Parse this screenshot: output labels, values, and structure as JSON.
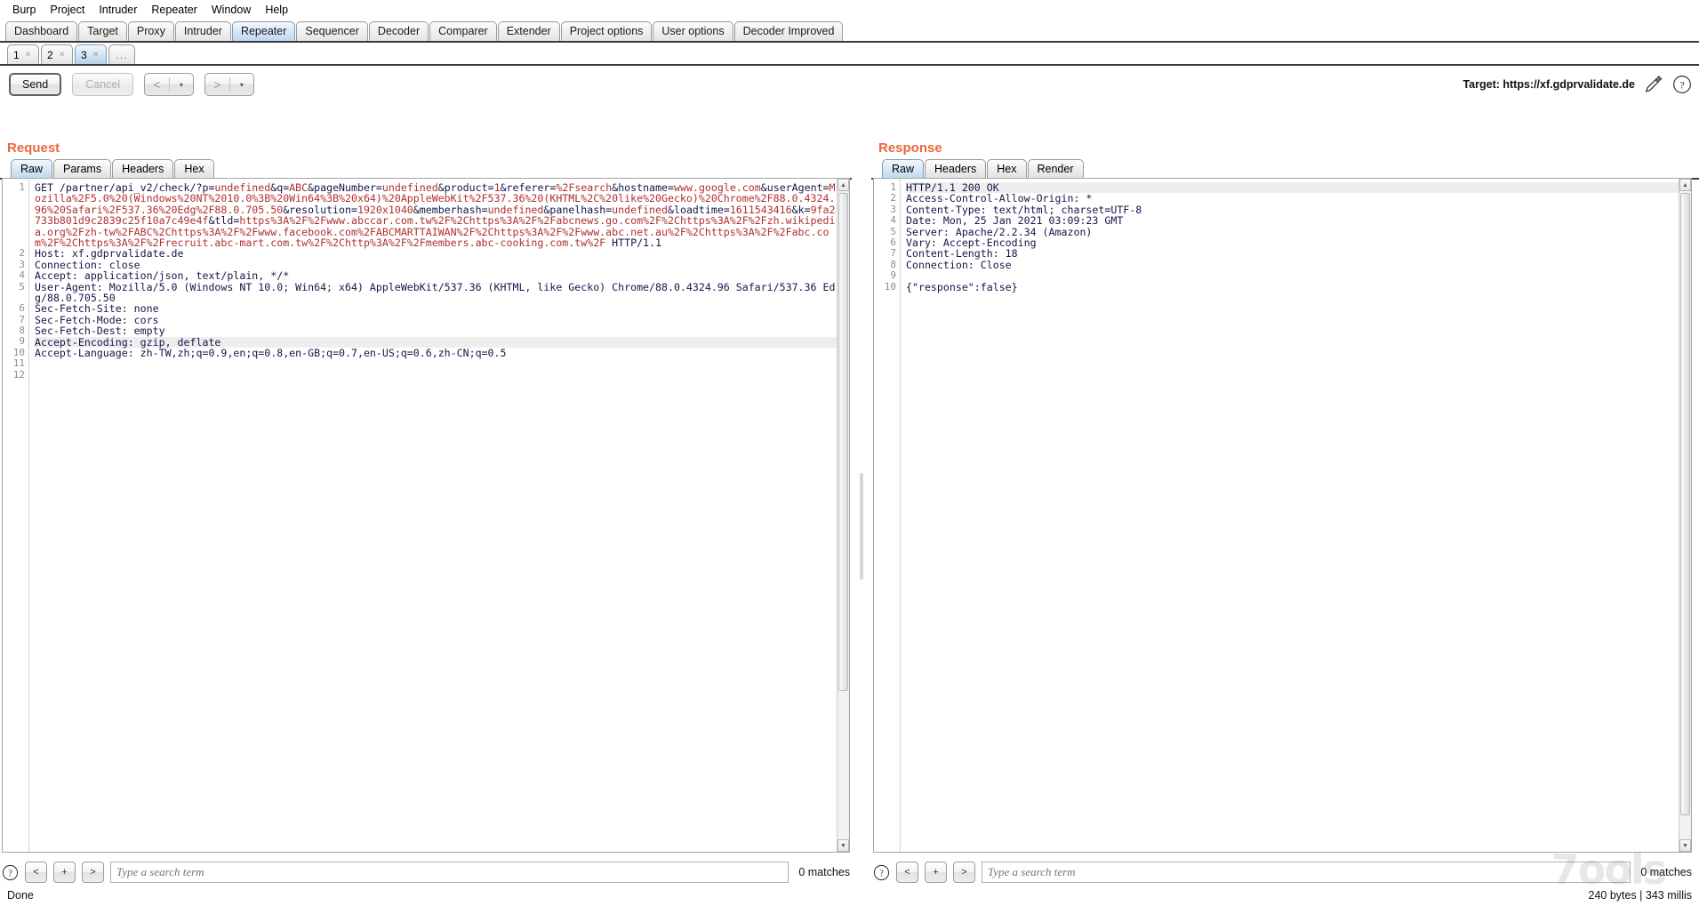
{
  "menu": {
    "items": [
      "Burp",
      "Project",
      "Intruder",
      "Repeater",
      "Window",
      "Help"
    ]
  },
  "main_tabs": {
    "selected": "Repeater",
    "items": [
      "Dashboard",
      "Target",
      "Proxy",
      "Intruder",
      "Repeater",
      "Sequencer",
      "Decoder",
      "Comparer",
      "Extender",
      "Project options",
      "User options",
      "Decoder Improved"
    ]
  },
  "repeater_tabs": {
    "selected": "3",
    "items": [
      "1",
      "2",
      "3"
    ],
    "close_glyph": "×",
    "more_label": "..."
  },
  "toolbar": {
    "send_label": "Send",
    "cancel_label": "Cancel",
    "back_glyph": "<",
    "forward_glyph": ">",
    "caret_glyph": "▾",
    "target_label": "Target: https://xf.gdprvalidate.de",
    "edit_icon": "pencil-icon",
    "help_icon": "question-mark-icon"
  },
  "request": {
    "title": "Request",
    "tabs": [
      "Raw",
      "Params",
      "Headers",
      "Hex"
    ],
    "selected_tab": "Raw",
    "line_numbers": [
      "1",
      "2",
      "3",
      "4",
      "5",
      "6",
      "7",
      "8",
      "9",
      "10",
      "11",
      "12"
    ],
    "lines": [
      {
        "n": "1",
        "segments": [
          {
            "t": "GET /partner/api_v2/check/?p=",
            "c": "blue"
          },
          {
            "t": "undefined",
            "c": "red"
          },
          {
            "t": "&q=",
            "c": "blue"
          },
          {
            "t": "ABC",
            "c": "red"
          },
          {
            "t": "&pageNumber=",
            "c": "blue"
          },
          {
            "t": "undefined",
            "c": "red"
          },
          {
            "t": "&product=",
            "c": "blue"
          },
          {
            "t": "1",
            "c": "red"
          },
          {
            "t": "&referer=",
            "c": "blue"
          },
          {
            "t": "%2Fsearch",
            "c": "red"
          },
          {
            "t": "&hostname=",
            "c": "blue"
          },
          {
            "t": "www.google.com",
            "c": "red"
          },
          {
            "t": "&userAgent=",
            "c": "blue"
          },
          {
            "t": "Mozilla%2F5.0%20(Windows%20NT%2010.0%3B%20Win64%3B%20x64)%20AppleWebKit%2F537.36%20(KHTML%2C%20like%20Gecko)%20Chrome%2F88.0.4324.96%20Safari%2F537.36%20Edg%2F88.0.705.50",
            "c": "red"
          },
          {
            "t": "&resolution=",
            "c": "blue"
          },
          {
            "t": "1920x1040",
            "c": "red"
          },
          {
            "t": "&memberhash=",
            "c": "blue"
          },
          {
            "t": "undefined",
            "c": "red"
          },
          {
            "t": "&panelhash=",
            "c": "blue"
          },
          {
            "t": "undefined",
            "c": "red"
          },
          {
            "t": "&loadtime=",
            "c": "blue"
          },
          {
            "t": "1611543416",
            "c": "red"
          },
          {
            "t": "&k=",
            "c": "blue"
          },
          {
            "t": "9fa2733b801d9c2839c25f10a7c49e4f",
            "c": "red"
          },
          {
            "t": "&tld=",
            "c": "blue"
          },
          {
            "t": "https%3A%2F%2Fwww.abccar.com.tw%2F%2Chttps%3A%2F%2Fabcnews.go.com%2F%2Chttps%3A%2F%2Fzh.wikipedia.org%2Fzh-tw%2FABC%2Chttps%3A%2F%2Fwww.facebook.com%2FABCMARTTAIWAN%2F%2Chttps%3A%2F%2Fwww.abc.net.au%2F%2Chttps%3A%2F%2Fabc.com%2F%2Chttps%3A%2F%2Frecruit.abc-mart.com.tw%2F%2Chttp%3A%2F%2Fmembers.abc-cooking.com.tw%2F",
            "c": "red"
          },
          {
            "t": " HTTP/1.1",
            "c": "blue"
          }
        ]
      },
      {
        "n": "2",
        "segments": [
          {
            "t": "Host: xf.gdprvalidate.de",
            "c": "blue"
          }
        ]
      },
      {
        "n": "3",
        "segments": [
          {
            "t": "Connection: close",
            "c": "blue"
          }
        ]
      },
      {
        "n": "4",
        "segments": [
          {
            "t": "Accept: application/json, text/plain, */*",
            "c": "blue"
          }
        ]
      },
      {
        "n": "5",
        "segments": [
          {
            "t": "User-Agent: Mozilla/5.0 (Windows NT 10.0; Win64; x64) AppleWebKit/537.36 (KHTML, like Gecko) Chrome/88.0.4324.96 Safari/537.36 Edg/88.0.705.50",
            "c": "blue"
          }
        ]
      },
      {
        "n": "6",
        "segments": [
          {
            "t": "Sec-Fetch-Site: none",
            "c": "blue"
          }
        ]
      },
      {
        "n": "7",
        "segments": [
          {
            "t": "Sec-Fetch-Mode: cors",
            "c": "blue"
          }
        ]
      },
      {
        "n": "8",
        "segments": [
          {
            "t": "Sec-Fetch-Dest: empty",
            "c": "blue"
          }
        ]
      },
      {
        "n": "9",
        "highlight": true,
        "segments": [
          {
            "t": "Accept-Encoding: gzip, deflate",
            "c": "blue"
          }
        ]
      },
      {
        "n": "10",
        "segments": [
          {
            "t": "Accept-Language: zh-TW,zh;q=0.9,en;q=0.8,en-GB;q=0.7,en-US;q=0.6,zh-CN;q=0.5",
            "c": "blue"
          }
        ]
      },
      {
        "n": "11",
        "segments": [
          {
            "t": "",
            "c": "blue"
          }
        ]
      },
      {
        "n": "12",
        "segments": [
          {
            "t": "",
            "c": "blue"
          }
        ]
      }
    ],
    "search": {
      "placeholder": "Type a search term",
      "value": "",
      "prev_glyph": "<",
      "add_glyph": "+",
      "next_glyph": ">",
      "matches": "0 matches",
      "help_icon": "question-mark-icon"
    }
  },
  "response": {
    "title": "Response",
    "tabs": [
      "Raw",
      "Headers",
      "Hex",
      "Render"
    ],
    "selected_tab": "Raw",
    "lines": [
      {
        "n": "1",
        "highlight": true,
        "segments": [
          {
            "t": "HTTP/1.1 200 OK",
            "c": "blue"
          }
        ]
      },
      {
        "n": "2",
        "segments": [
          {
            "t": "Access-Control-Allow-Origin: *",
            "c": "blue"
          }
        ]
      },
      {
        "n": "3",
        "segments": [
          {
            "t": "Content-Type: text/html; charset=UTF-8",
            "c": "blue"
          }
        ]
      },
      {
        "n": "4",
        "segments": [
          {
            "t": "Date: Mon, 25 Jan 2021 03:09:23 GMT",
            "c": "blue"
          }
        ]
      },
      {
        "n": "5",
        "segments": [
          {
            "t": "Server: Apache/2.2.34 (Amazon)",
            "c": "blue"
          }
        ]
      },
      {
        "n": "6",
        "segments": [
          {
            "t": "Vary: Accept-Encoding",
            "c": "blue"
          }
        ]
      },
      {
        "n": "7",
        "segments": [
          {
            "t": "Content-Length: 18",
            "c": "blue"
          }
        ]
      },
      {
        "n": "8",
        "segments": [
          {
            "t": "Connection: Close",
            "c": "blue"
          }
        ]
      },
      {
        "n": "9",
        "segments": [
          {
            "t": "",
            "c": "blue"
          }
        ]
      },
      {
        "n": "10",
        "segments": [
          {
            "t": "{\"response\":false}",
            "c": "blue"
          }
        ]
      }
    ],
    "search": {
      "placeholder": "Type a search term",
      "value": "",
      "prev_glyph": "<",
      "add_glyph": "+",
      "next_glyph": ">",
      "matches": "0 matches",
      "help_icon": "question-mark-icon"
    }
  },
  "statusbar": {
    "left": "Done",
    "right": "240 bytes | 343 millis"
  },
  "watermark": "7ools",
  "colors": {
    "pane_title": "#e8683d",
    "code_blue": "#16164a",
    "code_red": "#b03030",
    "tab_selected": "#c0daef"
  }
}
